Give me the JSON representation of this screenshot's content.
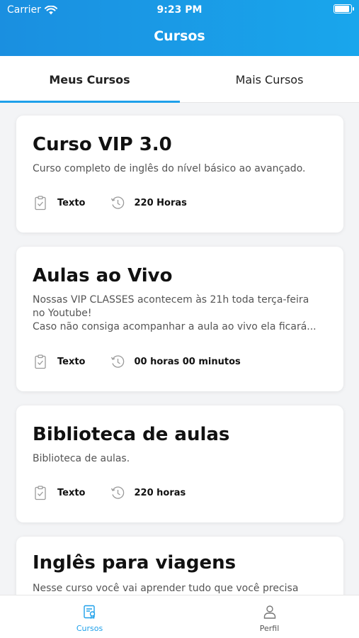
{
  "status_bar": {
    "carrier": "Carrier",
    "time": "9:23 PM"
  },
  "header": {
    "title": "Cursos"
  },
  "tabs": [
    {
      "label": "Meus Cursos",
      "active": true
    },
    {
      "label": "Mais Cursos",
      "active": false
    }
  ],
  "courses": [
    {
      "title": "Curso VIP 3.0",
      "description": [
        "Curso completo de inglês do nível básico ao avançado."
      ],
      "type": "Texto",
      "duration": "220 Horas"
    },
    {
      "title": "Aulas ao Vivo",
      "description": [
        "Nossas VIP CLASSES acontecem às 21h toda terça-feira",
        "no Youtube!",
        "Caso não consiga acompanhar a aula ao vivo ela ficará..."
      ],
      "type": "Texto",
      "duration": "00 horas 00 minutos"
    },
    {
      "title": "Biblioteca de aulas",
      "description": [
        "Biblioteca de aulas."
      ],
      "type": "Texto",
      "duration": "220 horas"
    },
    {
      "title": "Inglês para viagens",
      "description": [
        "Nesse curso você vai aprender tudo que você precisa"
      ]
    }
  ],
  "bottom_nav": [
    {
      "label": "Cursos",
      "icon": "courses-icon",
      "active": true
    },
    {
      "label": "Perfil",
      "icon": "profile-icon",
      "active": false
    }
  ],
  "colors": {
    "accent": "#1ea0ea",
    "inactive": "#555555",
    "icon_gray": "#9a9a9a"
  }
}
